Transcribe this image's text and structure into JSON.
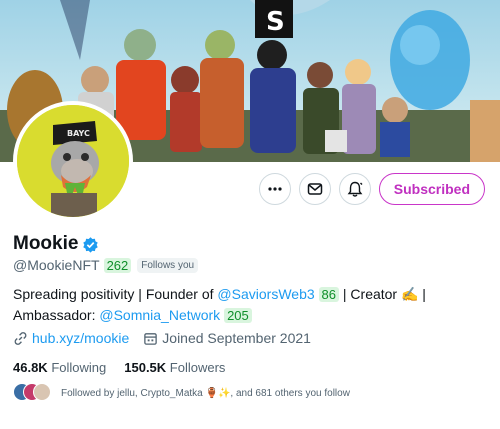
{
  "profile": {
    "name": "Mookie",
    "handle": "@MookieNFT",
    "handle_count": "262",
    "follows_you": "Follows you",
    "verified_icon": "verified-badge-icon"
  },
  "actions": {
    "more_icon": "more-icon",
    "message_icon": "envelope-icon",
    "notify_icon": "bell-icon",
    "subscribed_label": "Subscribed"
  },
  "bio": {
    "part1": "Spreading positivity | Founder of ",
    "mention1": "@SaviorsWeb3",
    "mention1_count": "86",
    "part2": " | Creator ✍️ | Ambassador: ",
    "mention2": "@Somnia_Network",
    "mention2_count": "205"
  },
  "meta": {
    "website": "hub.xyz/mookie",
    "joined": "Joined September 2021"
  },
  "stats": {
    "following_count": "46.8K",
    "following_label": "Following",
    "followers_count": "150.5K",
    "followers_label": "Followers"
  },
  "followed_by": {
    "text": "Followed by jellu, Crypto_Matka 🏺✨, and 681 others you follow"
  },
  "colors": {
    "link": "#1d9bf0",
    "subscribed": "#c030c0",
    "badge_green": "#0f8f2a",
    "avatar_bg": "#d9dc2f"
  }
}
